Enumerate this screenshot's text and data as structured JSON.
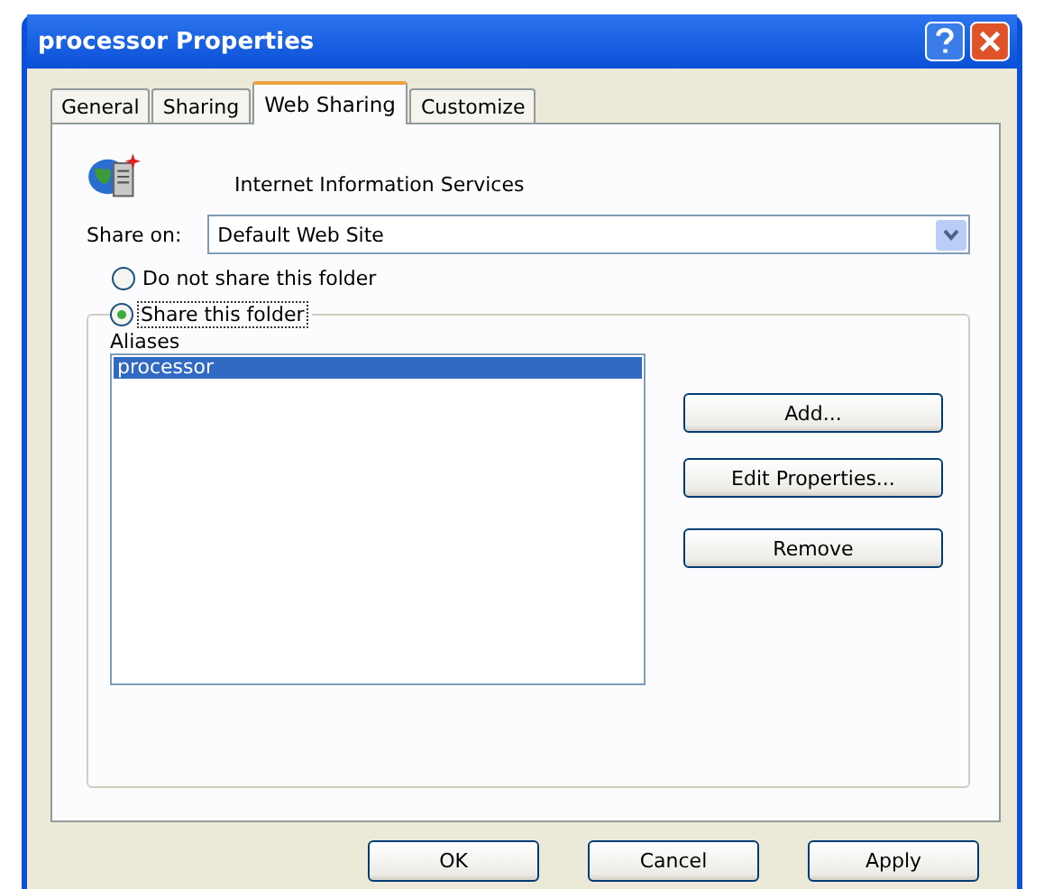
{
  "window": {
    "title": "processor Properties"
  },
  "tabs": [
    {
      "label": "General",
      "selected": false
    },
    {
      "label": "Sharing",
      "selected": false
    },
    {
      "label": "Web Sharing",
      "selected": true
    },
    {
      "label": "Customize",
      "selected": false
    }
  ],
  "service": {
    "label": "Internet Information Services"
  },
  "share_on": {
    "label": "Share on:",
    "value": "Default Web Site"
  },
  "options": [
    {
      "label": "Do not share this folder",
      "selected": false
    },
    {
      "label": "Share this folder",
      "selected": true
    }
  ],
  "aliases": {
    "label": "Aliases",
    "items": [
      {
        "label": "processor",
        "selected": true
      }
    ]
  },
  "alias_buttons": [
    "Add...",
    "Edit Properties...",
    "Remove"
  ],
  "buttons": [
    "OK",
    "Cancel",
    "Apply"
  ]
}
